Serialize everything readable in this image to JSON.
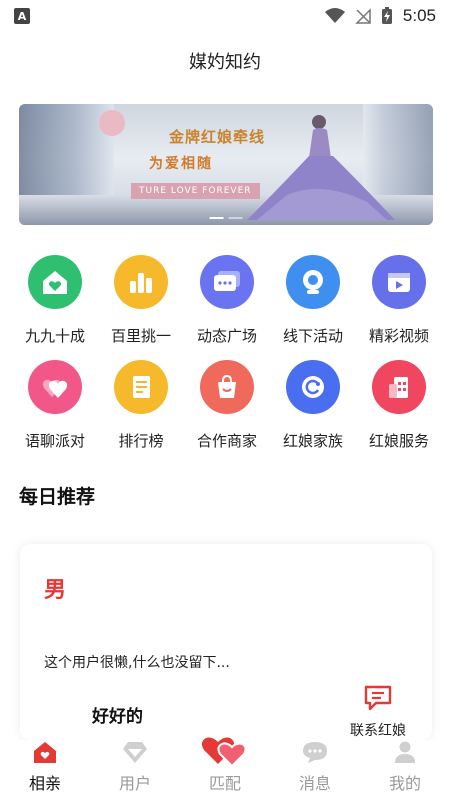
{
  "status_bar": {
    "time": "5:05",
    "notification_icon": "A"
  },
  "header": {
    "title": "媒妁知约"
  },
  "banner": {
    "line1": "金牌红娘牵线",
    "line2": "为爱相随",
    "tagline": "TURE LOVE FOREVER"
  },
  "features": [
    {
      "label": "九九十成",
      "icon": "home-heart-icon",
      "color": "#2fbf71"
    },
    {
      "label": "百里挑一",
      "icon": "bar-chart-icon",
      "color": "#f5b92b"
    },
    {
      "label": "动态广场",
      "icon": "chat-bubbles-icon",
      "color": "#6b74f0"
    },
    {
      "label": "线下活动",
      "icon": "webcam-icon",
      "color": "#3f8ff0"
    },
    {
      "label": "精彩视频",
      "icon": "video-play-icon",
      "color": "#6570ea"
    },
    {
      "label": "语聊派对",
      "icon": "hearts-icon",
      "color": "#f2578a"
    },
    {
      "label": "排行榜",
      "icon": "list-doc-icon",
      "color": "#f5b92b"
    },
    {
      "label": "合作商家",
      "icon": "shopping-bag-icon",
      "color": "#f06a5b"
    },
    {
      "label": "红娘家族",
      "icon": "refresh-circle-icon",
      "color": "#4a6ef0"
    },
    {
      "label": "红娘服务",
      "icon": "building-icon",
      "color": "#f0465f"
    }
  ],
  "daily": {
    "title": "每日推荐",
    "card": {
      "gender": "男",
      "bio": "这个用户很懒,什么也没留下...",
      "name": "好好的",
      "contact_label": "联系红娘"
    }
  },
  "tabbar": {
    "tabs": [
      {
        "label": "相亲",
        "icon": "home-icon",
        "active": true
      },
      {
        "label": "用户",
        "icon": "diamond-icon",
        "active": false
      },
      {
        "label": "匹配",
        "icon": "double-heart-icon",
        "active": false
      },
      {
        "label": "消息",
        "icon": "message-icon",
        "active": false
      },
      {
        "label": "我的",
        "icon": "person-icon",
        "active": false
      }
    ]
  },
  "colors": {
    "accent": "#e53935",
    "tab_inactive": "#bbbbbb"
  }
}
